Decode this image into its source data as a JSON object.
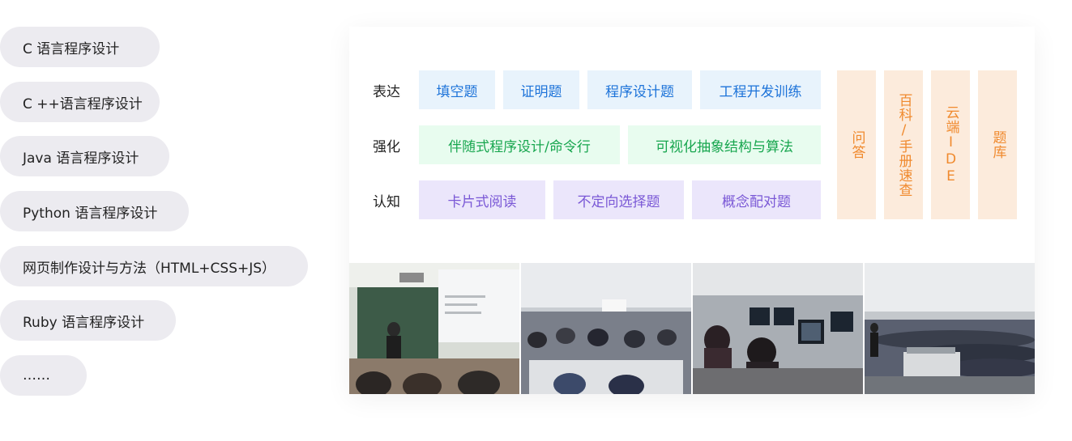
{
  "courses": [
    "C 语言程序设计",
    "C ++语言程序设计",
    "Java 语言程序设计",
    "Python 语言程序设计",
    "网页制作设计与方法（HTML+CSS+JS）",
    "Ruby 语言程序设计",
    "……"
  ],
  "matrix": {
    "rows": [
      {
        "label": "表达",
        "tags": [
          "填空题",
          "证明题",
          "程序设计题",
          "工程开发训练"
        ]
      },
      {
        "label": "强化",
        "tags": [
          "伴随式程序设计/命令行",
          "可视化抽象结构与算法"
        ]
      },
      {
        "label": "认知",
        "tags": [
          "卡片式阅读",
          "不定向选择题",
          "概念配对题"
        ]
      }
    ],
    "side_tags": [
      "问答",
      "百科/手册速查",
      "云端IDE",
      "题库"
    ]
  },
  "colors": {
    "pill_bg": "#ecebf0",
    "blue_bg": "#e8f3fc",
    "blue_text": "#1d73d9",
    "green_bg": "#e8fcef",
    "green_text": "#18a64f",
    "purple_bg": "#ebe6fb",
    "purple_text": "#7a58d6",
    "orange_bg": "#fcebdc",
    "orange_text": "#f08a2e"
  },
  "photos": [
    "classroom-lecture-photo",
    "classroom-students-photo",
    "computer-lab-photo",
    "lecture-hall-photo"
  ]
}
